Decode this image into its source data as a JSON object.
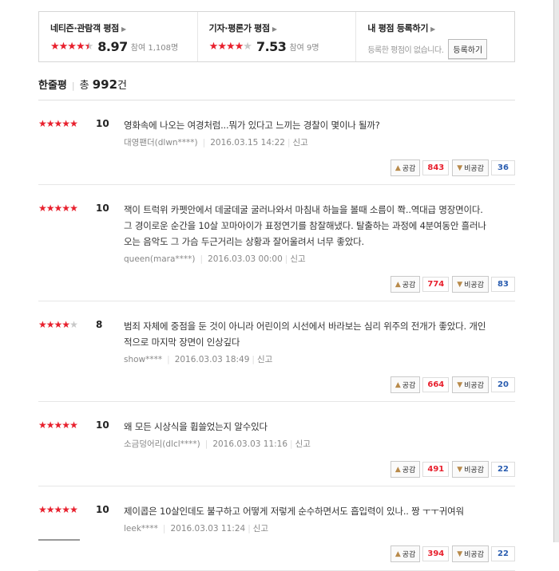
{
  "summary": {
    "netizen": {
      "title": "네티즌·관람객 평점",
      "score": "8.97",
      "participants": "참여 1,108명"
    },
    "critic": {
      "title": "기자·평론가 평점",
      "score": "7.53",
      "participants": "참여 9명"
    },
    "mine": {
      "title": "내 평점 등록하기",
      "empty_text": "등록한 평점이 없습니다.",
      "register_label": "등록하기"
    }
  },
  "list_header": {
    "title": "한줄평",
    "total_label": "총",
    "count": "992",
    "unit": "건"
  },
  "reviews": [
    {
      "score": "10",
      "stars": 5,
      "lines": [
        "영화속에 나오는 여경처럼...뭐가 있다고 느끼는 경찰이 몇이나 될까?"
      ],
      "author": "대영팬더(dlwn****)",
      "date": "2016.03.15 14:22",
      "report": "신고",
      "like_label": "공감",
      "likes": "843",
      "dislike_label": "비공감",
      "dislikes": "36"
    },
    {
      "score": "10",
      "stars": 5,
      "lines": [
        "잭이 트럭위 카펫안에서 데굴데굴 굴러나와서 마침내 하늘을 볼때 소름이 쫙..역대급 명장면이다.",
        "그 경이로운 순간을 10살 꼬마아이가 표정연기를 참잘해냈다. 탈출하는 과정에 4분여동안 흘러나",
        "오는 음악도 그 가슴 두근거리는 상황과 잘어울려서 너무 좋았다."
      ],
      "author": "queen(mara****)",
      "date": "2016.03.03 00:00",
      "report": "신고",
      "like_label": "공감",
      "likes": "774",
      "dislike_label": "비공감",
      "dislikes": "83"
    },
    {
      "score": "8",
      "stars": 4,
      "lines": [
        "범죄 자체에 중점을 둔 것이 아니라 어린이의 시선에서 바라보는 심리 위주의 전개가 좋았다. 개인",
        "적으로 마지막 장면이 인상깊다"
      ],
      "author": "show****",
      "date": "2016.03.03 18:49",
      "report": "신고",
      "like_label": "공감",
      "likes": "664",
      "dislike_label": "비공감",
      "dislikes": "20"
    },
    {
      "score": "10",
      "stars": 5,
      "lines": [
        "왜 모든 시상식을 휩쓸었는지 알수있다"
      ],
      "author": "소금덩어리(dlcl****)",
      "date": "2016.03.03 11:16",
      "report": "신고",
      "like_label": "공감",
      "likes": "491",
      "dislike_label": "비공감",
      "dislikes": "22"
    },
    {
      "score": "10",
      "stars": 5,
      "lines": [
        "제이콥은 10살인데도 불구하고 어떻게 저렇게 순수하면서도 흡입력이 있나.. 짱 ㅜㅜ귀여워"
      ],
      "author": "leek****",
      "date": "2016.03.03 11:24",
      "report": "신고",
      "like_label": "공감",
      "likes": "394",
      "dislike_label": "비공감",
      "dislikes": "22"
    }
  ],
  "colors": {
    "star_on": "#e8202d",
    "star_off": "#c8c8c8",
    "like_count": "#e8202d",
    "dislike_count": "#2a5db0"
  },
  "icons": {
    "arrow": "chevron-right-icon",
    "like": "thumbs-up-icon",
    "dislike": "thumbs-down-icon"
  }
}
